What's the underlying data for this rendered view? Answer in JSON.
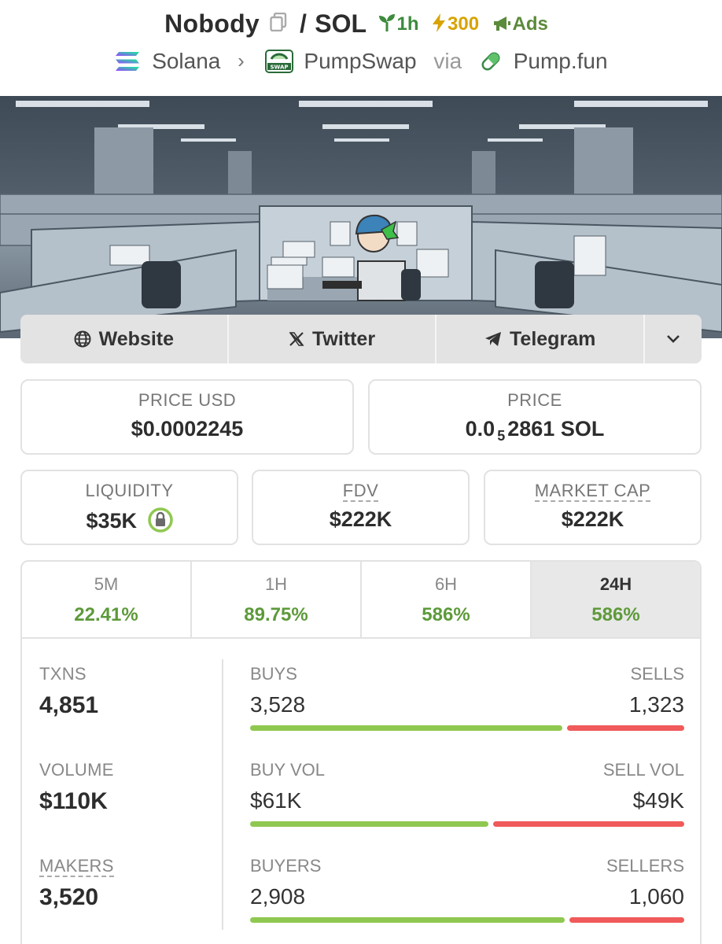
{
  "header": {
    "token_name": "Nobody",
    "slash": "/",
    "quote": "SOL",
    "age_badge": "1h",
    "boost_badge": "300",
    "ads_badge": "Ads",
    "chain": "Solana",
    "dex": "PumpSwap",
    "via": "via",
    "launchpad": "Pump.fun"
  },
  "social": {
    "website": "Website",
    "twitter": "Twitter",
    "telegram": "Telegram"
  },
  "price": {
    "usd_label": "PRICE USD",
    "usd_value": "$0.0002245",
    "native_label": "PRICE",
    "native_prefix": "0.0",
    "native_zeros": "5",
    "native_digits": "2861",
    "native_unit": "SOL"
  },
  "metrics": {
    "liquidity_label": "LIQUIDITY",
    "liquidity_value": "$35K",
    "fdv_label": "FDV",
    "fdv_value": "$222K",
    "mcap_label": "MARKET CAP",
    "mcap_value": "$222K"
  },
  "timeframes": [
    {
      "label": "5M",
      "change": "22.41%"
    },
    {
      "label": "1H",
      "change": "89.75%"
    },
    {
      "label": "6H",
      "change": "586%"
    },
    {
      "label": "24H",
      "change": "586%"
    }
  ],
  "stats": {
    "txns_label": "TXNS",
    "txns_value": "4,851",
    "volume_label": "VOLUME",
    "volume_value": "$110K",
    "makers_label": "MAKERS",
    "makers_value": "3,520",
    "rows": [
      {
        "left_label": "BUYS",
        "left_value": "3,528",
        "right_label": "SELLS",
        "right_value": "1,323",
        "buy_fraction": 0.727
      },
      {
        "left_label": "BUY VOL",
        "left_value": "$61K",
        "right_label": "SELL VOL",
        "right_value": "$49K",
        "buy_fraction": 0.555
      },
      {
        "left_label": "BUYERS",
        "left_value": "2,908",
        "right_label": "SELLERS",
        "right_value": "1,060",
        "buy_fraction": 0.733
      }
    ]
  },
  "colors": {
    "positive": "#5d9a3a",
    "buy_bar": "#8fc850",
    "sell_bar": "#f05a5a"
  }
}
